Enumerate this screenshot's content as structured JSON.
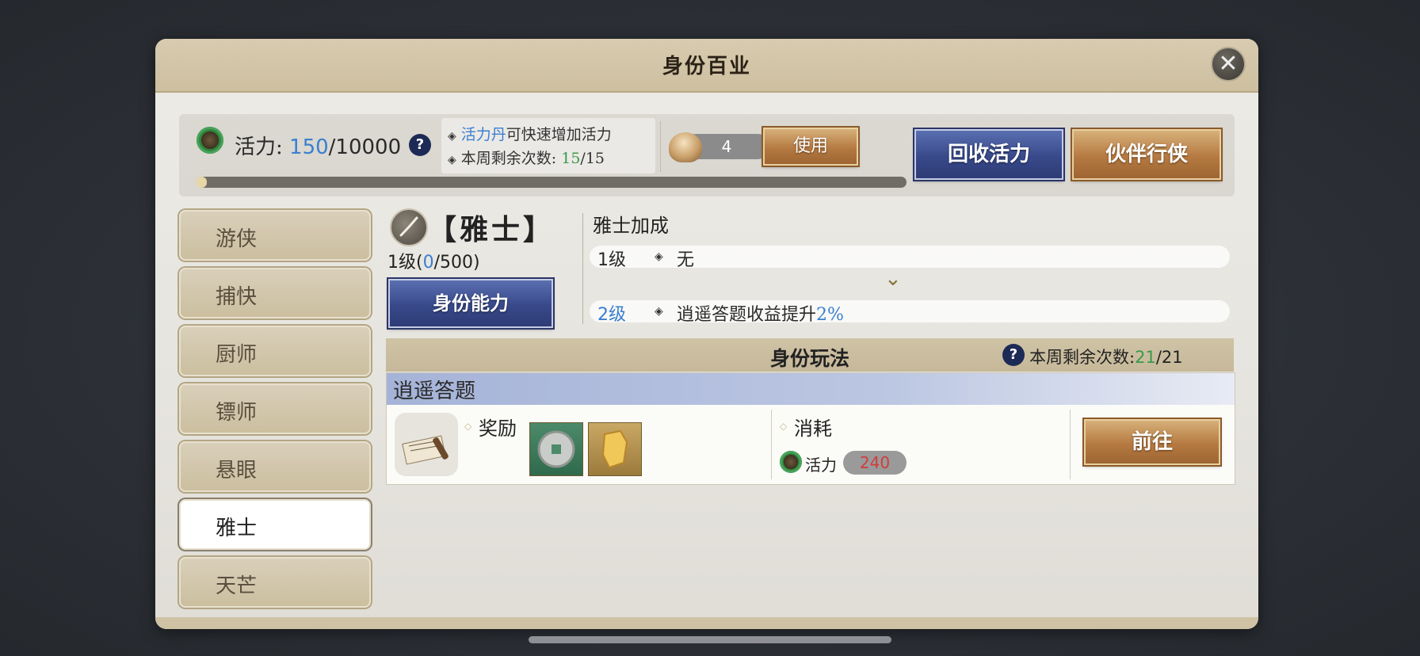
{
  "panel": {
    "title": "身份百业",
    "close_symbol": "✕"
  },
  "vigor": {
    "label": "活力:",
    "current": "150",
    "max": "/10000",
    "help": "?",
    "progress_fraction": 0.015
  },
  "info": {
    "line1_highlight": "活力丹",
    "line1_rest": "可快速增加活力",
    "line2_label": "本周剩余次数:",
    "line2_current": "15",
    "line2_max": "/15"
  },
  "item": {
    "count": "4",
    "use_label": "使用"
  },
  "buttons": {
    "recycle": "回收活力",
    "partner": "伙伴行侠"
  },
  "sidebar": {
    "items": [
      {
        "label": "游侠",
        "active": false
      },
      {
        "label": "捕快",
        "active": false
      },
      {
        "label": "厨师",
        "active": false
      },
      {
        "label": "镖师",
        "active": false
      },
      {
        "label": "悬眼",
        "active": false
      },
      {
        "label": "雅士",
        "active": true
      },
      {
        "label": "天芒",
        "active": false
      }
    ]
  },
  "identity": {
    "name": "【雅士】",
    "level_prefix": "1级(",
    "level_current": "0",
    "level_max": "/500)",
    "ability_button": "身份能力"
  },
  "bonus": {
    "title": "雅士加成",
    "row1_level": "1级",
    "row1_text": "无",
    "arrow": "⌄",
    "row2_level": "2级",
    "row2_text": "逍遥答题收益提升",
    "row2_value": "2%"
  },
  "gameplay": {
    "title": "身份玩法",
    "help": "?",
    "remaining_label": "本周剩余次数:",
    "remaining_current": "21",
    "remaining_max": "/21"
  },
  "card": {
    "name": "逍遥答题",
    "reward_label": "奖励",
    "cost_label": "消耗",
    "cost_resource": "活力",
    "cost_value": "240",
    "go_button": "前往"
  },
  "colors": {
    "accent_blue": "#3a7fd0",
    "count_green": "#3a9a4a",
    "cost_red": "#d23c3c"
  }
}
